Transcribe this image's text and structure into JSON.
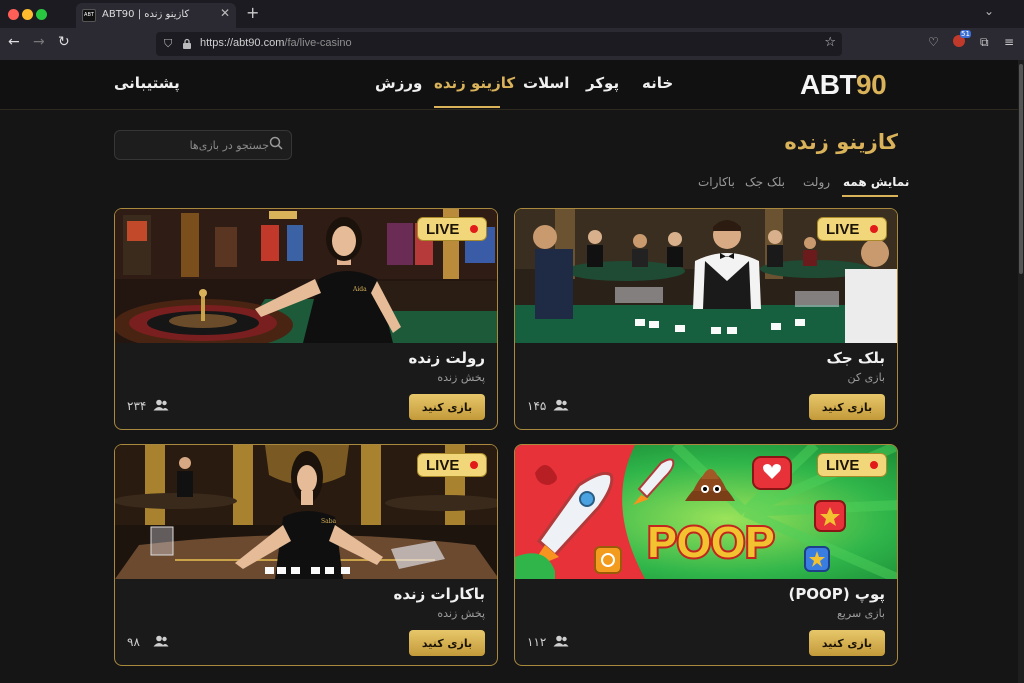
{
  "browser": {
    "tab_title": "کازینو زنده | ABT90",
    "favicon_text": "ABT",
    "url_host": "https://abt90.com",
    "url_path": "/fa/live-casino",
    "extension_badge": "51"
  },
  "header": {
    "logo_white": "ABT",
    "logo_gold": "90",
    "nav": {
      "home": "خانه",
      "poker": "پوکر",
      "slots": "اسلات",
      "live_casino": "کازینو زنده",
      "sports": "ورزش"
    },
    "support": "پشتیبانی"
  },
  "main": {
    "title": "کازینو زنده",
    "search_placeholder": "جستجو در بازی‌ها",
    "filters": {
      "all": "نمایش همه",
      "roulette": "رولت",
      "blackjack": "بلک جک",
      "baccarat": "باکارات"
    }
  },
  "live_badge": "LIVE",
  "cards": {
    "blackjack": {
      "name": "بلک جک",
      "subtitle": "بازی کن",
      "button": "بازی کنید",
      "players": "۱۴۵"
    },
    "roulette": {
      "name": "رولت زنده",
      "subtitle": "پخش زنده",
      "button": "بازی کنید",
      "players": "۲۳۴"
    },
    "poop": {
      "name": "پوپ (POOP)",
      "subtitle": "بازی سریع",
      "button": "بازی کنید",
      "players": "۱۱۲",
      "art_text": "POOP"
    },
    "baccarat": {
      "name": "باکارات زنده",
      "subtitle": "پخش زنده",
      "button": "بازی کنید",
      "players": "۹۸"
    }
  },
  "colors": {
    "gold": "#d9b25a",
    "background": "#151515",
    "card_border": "#a8893d",
    "live_badge": "#f2d67a"
  }
}
